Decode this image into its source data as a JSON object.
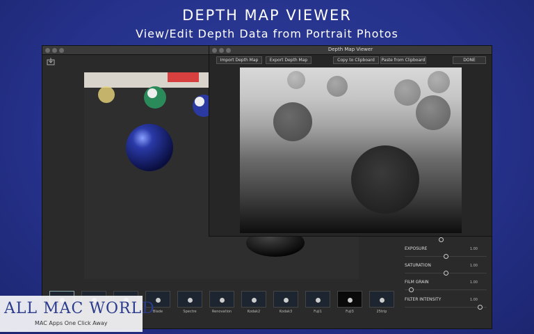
{
  "hero": {
    "title": "DEPTH MAP VIEWER",
    "subtitle": "View/Edit Depth Data from Portrait Photos"
  },
  "depth_window": {
    "title": "Depth Map Viewer",
    "buttons": {
      "import": "Import Depth Map",
      "export": "Export Depth Map",
      "copy": "Copy to Clipboard",
      "paste": "Paste from Clipboard",
      "done": "DONE"
    }
  },
  "filmstrip": [
    {
      "label": ""
    },
    {
      "label": ""
    },
    {
      "label": ""
    },
    {
      "label": "Blade"
    },
    {
      "label": "Spectre"
    },
    {
      "label": "Renovation"
    },
    {
      "label": "Kodak2"
    },
    {
      "label": "Kodak3"
    },
    {
      "label": "Fuji1"
    },
    {
      "label": "Fuji3"
    },
    {
      "label": "25trip"
    }
  ],
  "adjustments": [
    {
      "label": "",
      "value": ""
    },
    {
      "label": "EXPOSURE",
      "value": "1.00",
      "level": 0.5
    },
    {
      "label": "SATURATION",
      "value": "1.00",
      "level": 0.5
    },
    {
      "label": "FILM GRAIN",
      "value": "1.00",
      "level": 0.05
    },
    {
      "label": "FILTER INTENSITY",
      "value": "1.00",
      "level": 0.95
    }
  ],
  "watermark": {
    "main": "ALL MAC WORLD",
    "sub": "MAC Apps One Click Away"
  }
}
